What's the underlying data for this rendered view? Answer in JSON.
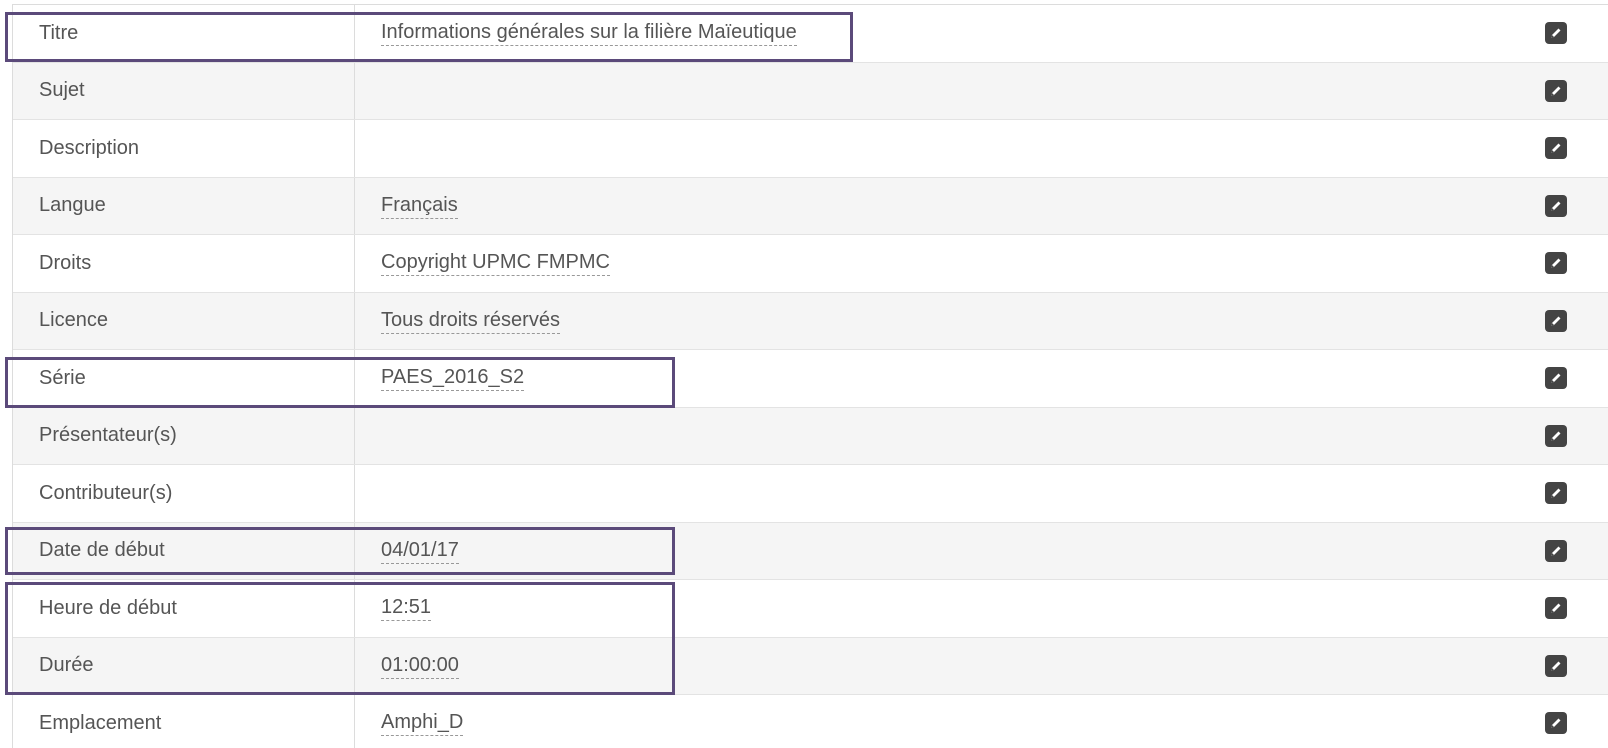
{
  "metadata_table": {
    "rows": [
      {
        "label": "Titre",
        "value": "Informations générales sur la filière Maïeutique"
      },
      {
        "label": "Sujet",
        "value": ""
      },
      {
        "label": "Description",
        "value": ""
      },
      {
        "label": "Langue",
        "value": "Français"
      },
      {
        "label": "Droits",
        "value": "Copyright UPMC FMPMC"
      },
      {
        "label": "Licence",
        "value": "Tous droits réservés"
      },
      {
        "label": "Série",
        "value": "PAES_2016_S2"
      },
      {
        "label": "Présentateur(s)",
        "value": ""
      },
      {
        "label": "Contributeur(s)",
        "value": ""
      },
      {
        "label": "Date de début",
        "value": "04/01/17"
      },
      {
        "label": "Heure de début",
        "value": "12:51"
      },
      {
        "label": "Durée",
        "value": "01:00:00"
      },
      {
        "label": "Emplacement",
        "value": "Amphi_D"
      }
    ],
    "edit_icon": "pencil-icon"
  },
  "highlight_color": "#5b4a7a"
}
